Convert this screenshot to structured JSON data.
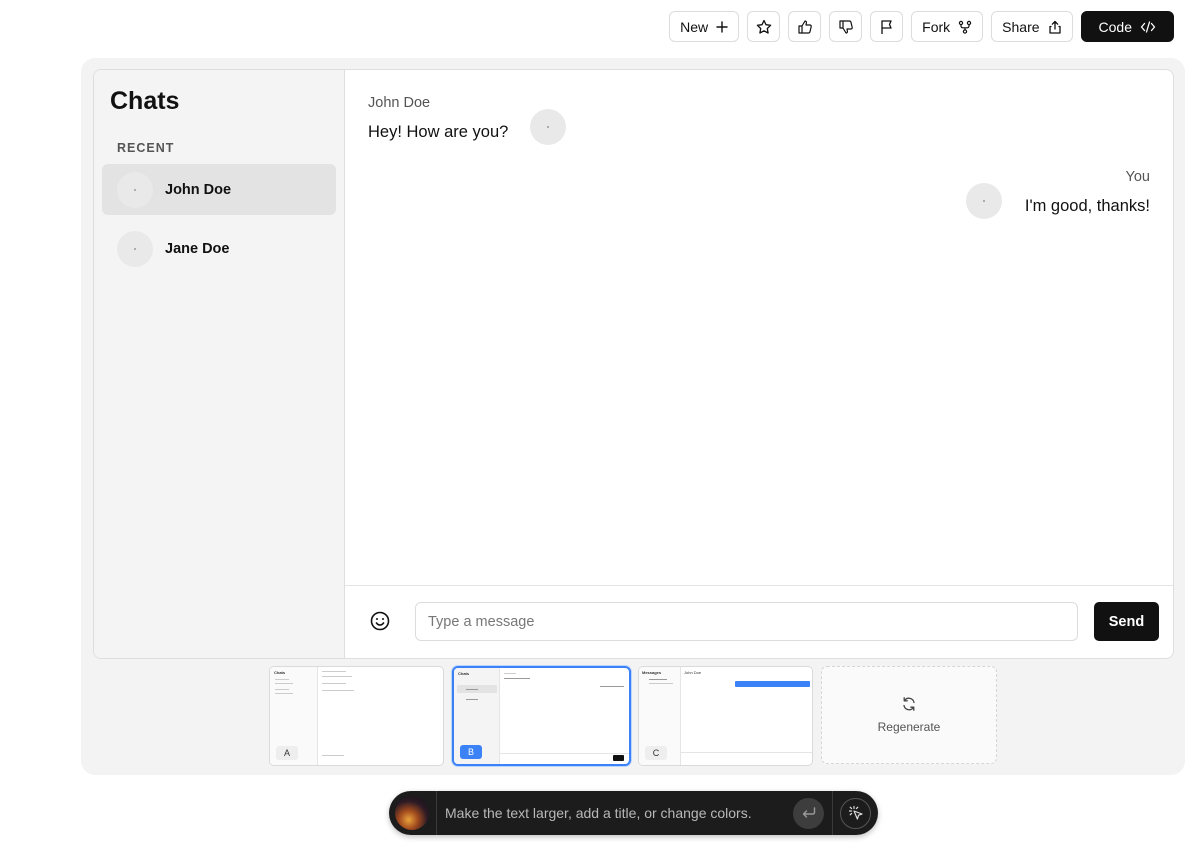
{
  "toolbar": {
    "new_label": "New",
    "fork_label": "Fork",
    "share_label": "Share",
    "code_label": "Code",
    "icons": [
      "plus-icon",
      "star-icon",
      "thumbs-up-icon",
      "thumbs-down-icon",
      "flag-icon",
      "fork-icon",
      "share-icon",
      "code-icon"
    ]
  },
  "sidebar": {
    "title": "Chats",
    "section_label": "RECENT",
    "items": [
      {
        "name": "John Doe",
        "active": true
      },
      {
        "name": "Jane Doe",
        "active": false
      }
    ]
  },
  "conversation": {
    "messages": [
      {
        "sender": "John Doe",
        "text": "Hey! How are you?",
        "side": "left"
      },
      {
        "sender": "You",
        "text": "I'm good, thanks!",
        "side": "right"
      }
    ]
  },
  "composer": {
    "placeholder": "Type a message",
    "send_label": "Send"
  },
  "variants": {
    "items": [
      {
        "label": "A",
        "selected": false
      },
      {
        "label": "B",
        "selected": true
      },
      {
        "label": "C",
        "selected": false
      }
    ],
    "regenerate_label": "Regenerate"
  },
  "prompt_bar": {
    "placeholder": "Make the text larger, add a title, or change colors."
  },
  "colors": {
    "accent": "#3b82f6",
    "dark_button": "#111111",
    "sidebar_bg": "#f4f4f4",
    "active_item_bg": "#e3e3e3"
  }
}
